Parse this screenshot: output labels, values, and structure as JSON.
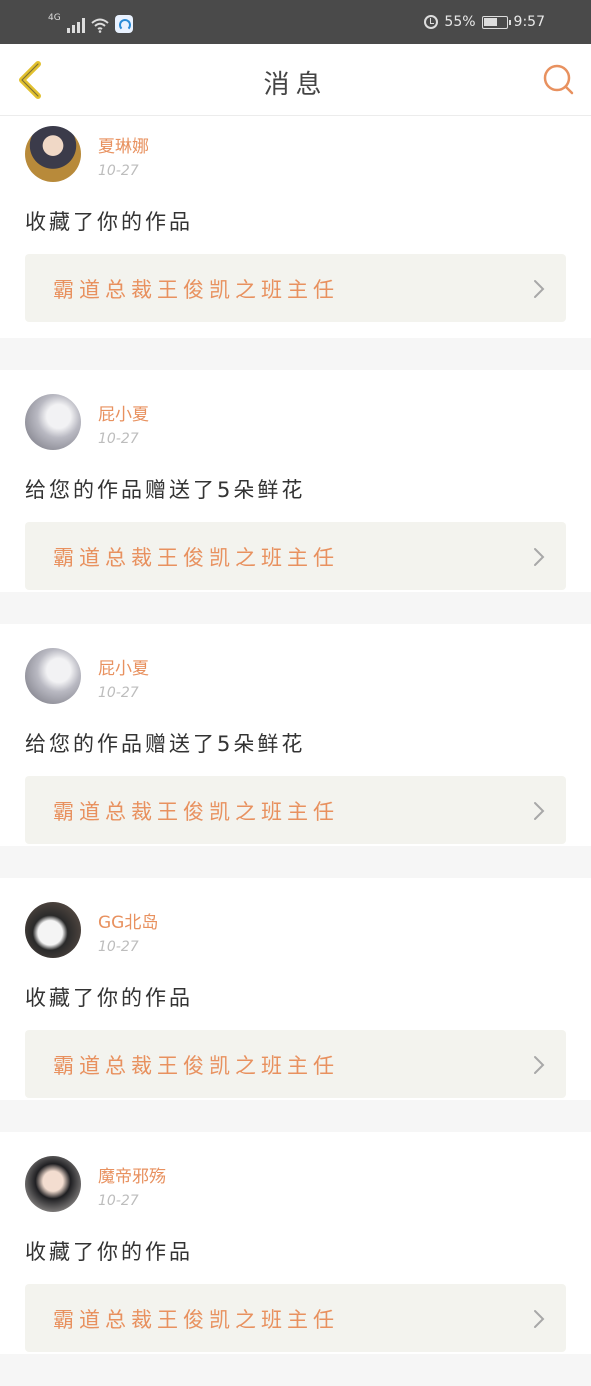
{
  "status_bar": {
    "network": "4G",
    "battery": "55%",
    "time": "9:57",
    "icons": [
      "signal-icon",
      "wifi-icon",
      "app-notification-icon",
      "alarm-icon",
      "battery-icon"
    ]
  },
  "header": {
    "title": "消息",
    "back_icon": "chevron-left-icon",
    "search_icon": "search-icon"
  },
  "colors": {
    "accent": "#e8915f",
    "back_icon": "#e2c12f",
    "page_bg": "#f6f6f6",
    "card_bg": "#ffffff",
    "link_bg": "#f3f3ee"
  },
  "messages": [
    {
      "user": "夏琳娜",
      "date": "10-27",
      "action": "收藏了你的作品",
      "work": "霸道总裁王俊凯之班主任"
    },
    {
      "user": "屁小夏",
      "date": "10-27",
      "action": "给您的作品赠送了5朵鲜花",
      "work": "霸道总裁王俊凯之班主任"
    },
    {
      "user": "屁小夏",
      "date": "10-27",
      "action": "给您的作品赠送了5朵鲜花",
      "work": "霸道总裁王俊凯之班主任"
    },
    {
      "user": "GG北岛",
      "date": "10-27",
      "action": "收藏了你的作品",
      "work": "霸道总裁王俊凯之班主任"
    },
    {
      "user": "魔帝邪殇",
      "date": "10-27",
      "action": "收藏了你的作品",
      "work": "霸道总裁王俊凯之班主任"
    }
  ]
}
